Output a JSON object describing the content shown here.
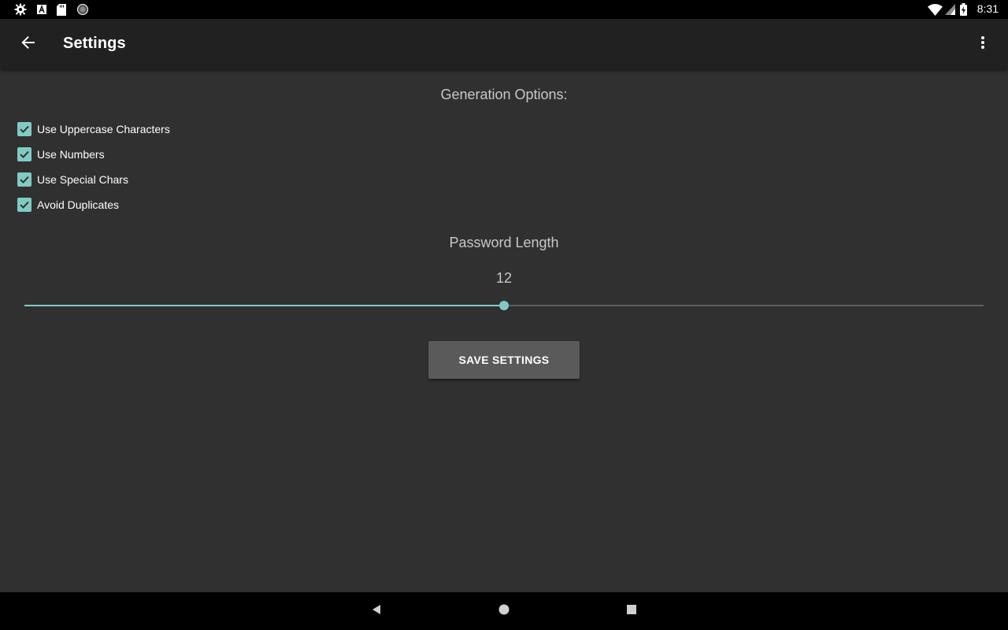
{
  "status_bar": {
    "time": "8:31",
    "left_icons": [
      "settings-icon",
      "font-icon",
      "sd-card-icon",
      "circle-icon"
    ],
    "right_icons": [
      "wifi-icon",
      "cell-signal-icon",
      "battery-charging-icon"
    ]
  },
  "app_bar": {
    "title": "Settings",
    "back_icon": "arrow-back-icon",
    "menu_icon": "more-vert-icon"
  },
  "generation_options": {
    "title": "Generation Options:",
    "checkboxes": [
      {
        "label": "Use Uppercase Characters",
        "checked": true
      },
      {
        "label": "Use Numbers",
        "checked": true
      },
      {
        "label": "Use Special Chars",
        "checked": true
      },
      {
        "label": "Avoid Duplicates",
        "checked": true
      }
    ]
  },
  "password_length": {
    "label": "Password Length",
    "value": "12",
    "slider_fraction": 0.5
  },
  "save_button": {
    "label": "SAVE SETTINGS"
  },
  "nav_bar": {
    "icons": [
      "back-triangle-icon",
      "home-circle-icon",
      "recents-square-icon"
    ]
  },
  "colors": {
    "accent": "#80cbc4",
    "background": "#303030",
    "app_bar": "#212121",
    "button": "#5a5a5a"
  }
}
